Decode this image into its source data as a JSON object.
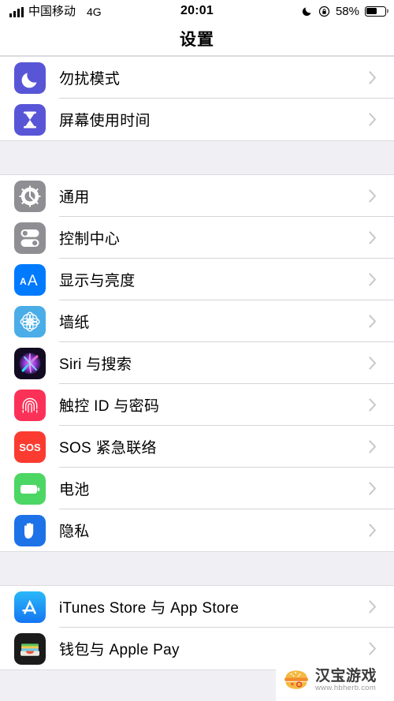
{
  "status_bar": {
    "carrier": "中国移动",
    "network": "4G",
    "time": "20:01",
    "battery_percent": "58%",
    "battery_level": 58,
    "dnd_icon": "moon-icon",
    "rotation_lock_icon": "rotation-lock-icon",
    "signal_icon": "signal-bars-icon",
    "battery_icon": "battery-icon"
  },
  "nav": {
    "title": "设置"
  },
  "colors": {
    "purple": "#5856D6",
    "gray": "#8E8E93",
    "blue": "#007AFF",
    "light_blue": "#4AADE8",
    "pink": "#FC3158",
    "red": "#FB3B30",
    "green": "#4CD663",
    "privacy_blue": "#1D72E8",
    "appstore_blue": "#28A9F7",
    "wallet_black": "#1B1B1B",
    "separator": "#D5D5D9",
    "page_bg": "#EFEFF4",
    "chevron": "#C7C7CC"
  },
  "groups": [
    {
      "name": "group-dnd-screentime",
      "rows": [
        {
          "label": "勿扰模式",
          "icon": "do-not-disturb-icon",
          "icon_style": "dnd"
        },
        {
          "label": "屏幕使用时间",
          "icon": "screen-time-icon",
          "icon_style": "screentime"
        }
      ]
    },
    {
      "name": "group-system",
      "rows": [
        {
          "label": "通用",
          "icon": "general-gear-icon",
          "icon_style": "general"
        },
        {
          "label": "控制中心",
          "icon": "control-center-icon",
          "icon_style": "control"
        },
        {
          "label": "显示与亮度",
          "icon": "display-brightness-icon",
          "icon_style": "display"
        },
        {
          "label": "墙纸",
          "icon": "wallpaper-icon",
          "icon_style": "wallpaper"
        },
        {
          "label": "Siri 与搜索",
          "icon": "siri-icon",
          "icon_style": "siri"
        },
        {
          "label": "触控 ID 与密码",
          "icon": "touch-id-icon",
          "icon_style": "touchid"
        },
        {
          "label": "SOS 紧急联络",
          "icon": "emergency-sos-icon",
          "icon_style": "sos"
        },
        {
          "label": "电池",
          "icon": "battery-settings-icon",
          "icon_style": "battery"
        },
        {
          "label": "隐私",
          "icon": "privacy-hand-icon",
          "icon_style": "privacy"
        }
      ]
    },
    {
      "name": "group-stores",
      "rows": [
        {
          "label": "iTunes Store 与 App Store",
          "icon": "app-store-icon",
          "icon_style": "appstore"
        },
        {
          "label": "钱包与 Apple Pay",
          "icon": "wallet-icon",
          "icon_style": "wallet"
        }
      ]
    }
  ],
  "watermark": {
    "brand": "汉宝游戏",
    "url": "www.hbherb.com",
    "icon": "burger-icon"
  }
}
